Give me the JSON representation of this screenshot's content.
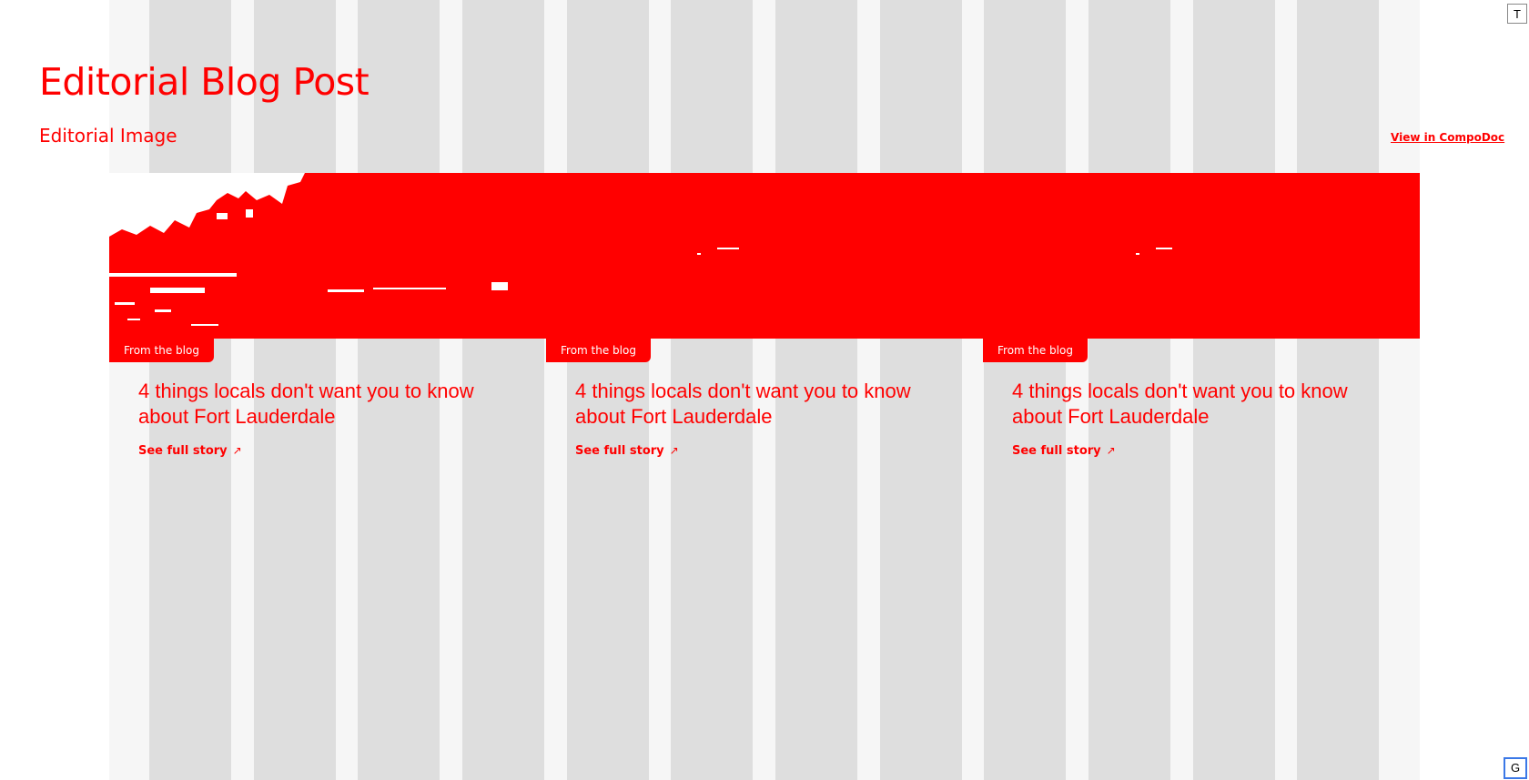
{
  "page": {
    "title": "Editorial Blog Post",
    "section_title": "Editorial Image",
    "compodoc_link": "View in CompoDoc"
  },
  "cards": [
    {
      "tag": "From the blog",
      "title": "4 things locals don't want you to know about Fort Lauderdale",
      "link": "See full story",
      "link_icon": "arrow-up-right-icon"
    },
    {
      "tag": "From the blog",
      "title": "4 things locals don't want you to know about Fort Lauderdale",
      "link": "See full story",
      "link_icon": "arrow-up-right-icon"
    },
    {
      "tag": "From the blog",
      "title": "4 things locals don't want you to know about Fort Lauderdale",
      "link": "See full story",
      "link_icon": "arrow-up-right-icon"
    }
  ],
  "corner_buttons": {
    "top": "T",
    "bottom": "G"
  },
  "colors": {
    "accent": "#ff0000",
    "grid_column": "#dedede",
    "grid_gutter": "#f6f6f6",
    "background": "#ffffff"
  }
}
